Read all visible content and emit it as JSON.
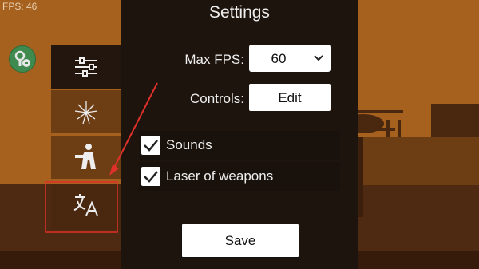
{
  "hud": {
    "fps_text": "FPS: 46"
  },
  "settings": {
    "title": "Settings",
    "max_fps": {
      "label": "Max FPS:",
      "value": "60"
    },
    "controls": {
      "label": "Controls:",
      "button": "Edit"
    },
    "options": [
      {
        "label": "Sounds",
        "checked": true
      },
      {
        "label": "Laser of weapons",
        "checked": true
      }
    ],
    "save_label": "Save"
  },
  "sidebar": {
    "items": [
      {
        "name": "settings",
        "icon": "sliders-icon",
        "active": true
      },
      {
        "name": "graphics",
        "icon": "fireworks-icon",
        "active": false
      },
      {
        "name": "controls",
        "icon": "gesture-person-icon",
        "active": false
      },
      {
        "name": "language",
        "icon": "translate-icon",
        "active": false
      }
    ]
  },
  "colors": {
    "background": "#a7611f",
    "panel": "#1d140e",
    "sidebar_active": "#23160e",
    "sidebar_inactive": "#6d3d14",
    "highlight_annotation": "#e0302a"
  }
}
